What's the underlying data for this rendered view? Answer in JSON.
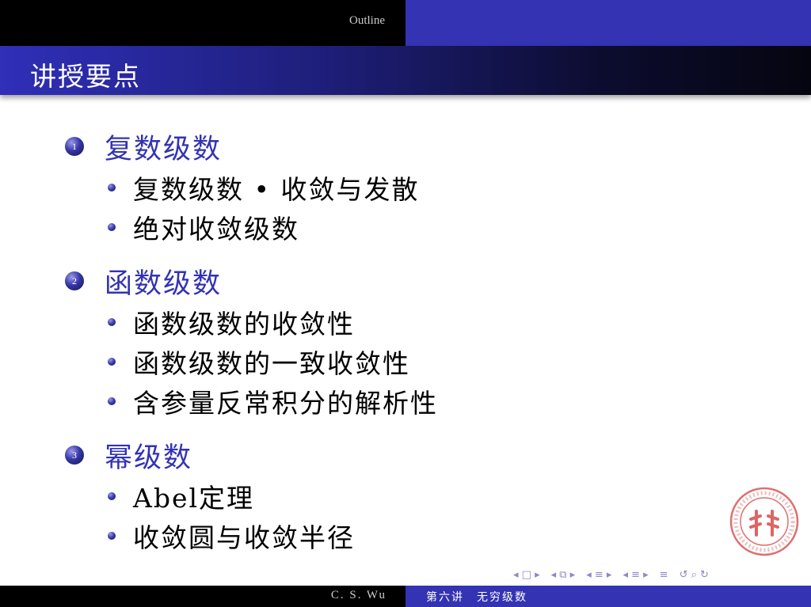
{
  "header": {
    "outline_label": "Outline",
    "frame_title": "讲授要点"
  },
  "outline": [
    {
      "number": "1",
      "title": "复数级数",
      "items": [
        "复数级数 • 收敛与发散",
        "绝对收敛级数"
      ]
    },
    {
      "number": "2",
      "title": "函数级数",
      "items": [
        "函数级数的收敛性",
        "函数级数的一致收敛性",
        "含参量反常积分的解析性"
      ]
    },
    {
      "number": "3",
      "title": "幂级数",
      "items": [
        "Abel定理",
        "收敛圆与收敛半径"
      ]
    }
  ],
  "navigation": {
    "frame_nav": "◂ □ ▸",
    "subsection_nav": "◂ ⧉ ▸",
    "section_nav": "◂ ≡ ▸",
    "doc_nav": "◂ ≡ ▸",
    "outline_sym": "≡",
    "search_sym": "↺ ⌕ ↻"
  },
  "footer": {
    "author": "C. S. Wu",
    "lecture": "第六讲　无穷级数"
  },
  "colors": {
    "beamer_blue": "#3333b3",
    "seal_red": "#d24040"
  }
}
